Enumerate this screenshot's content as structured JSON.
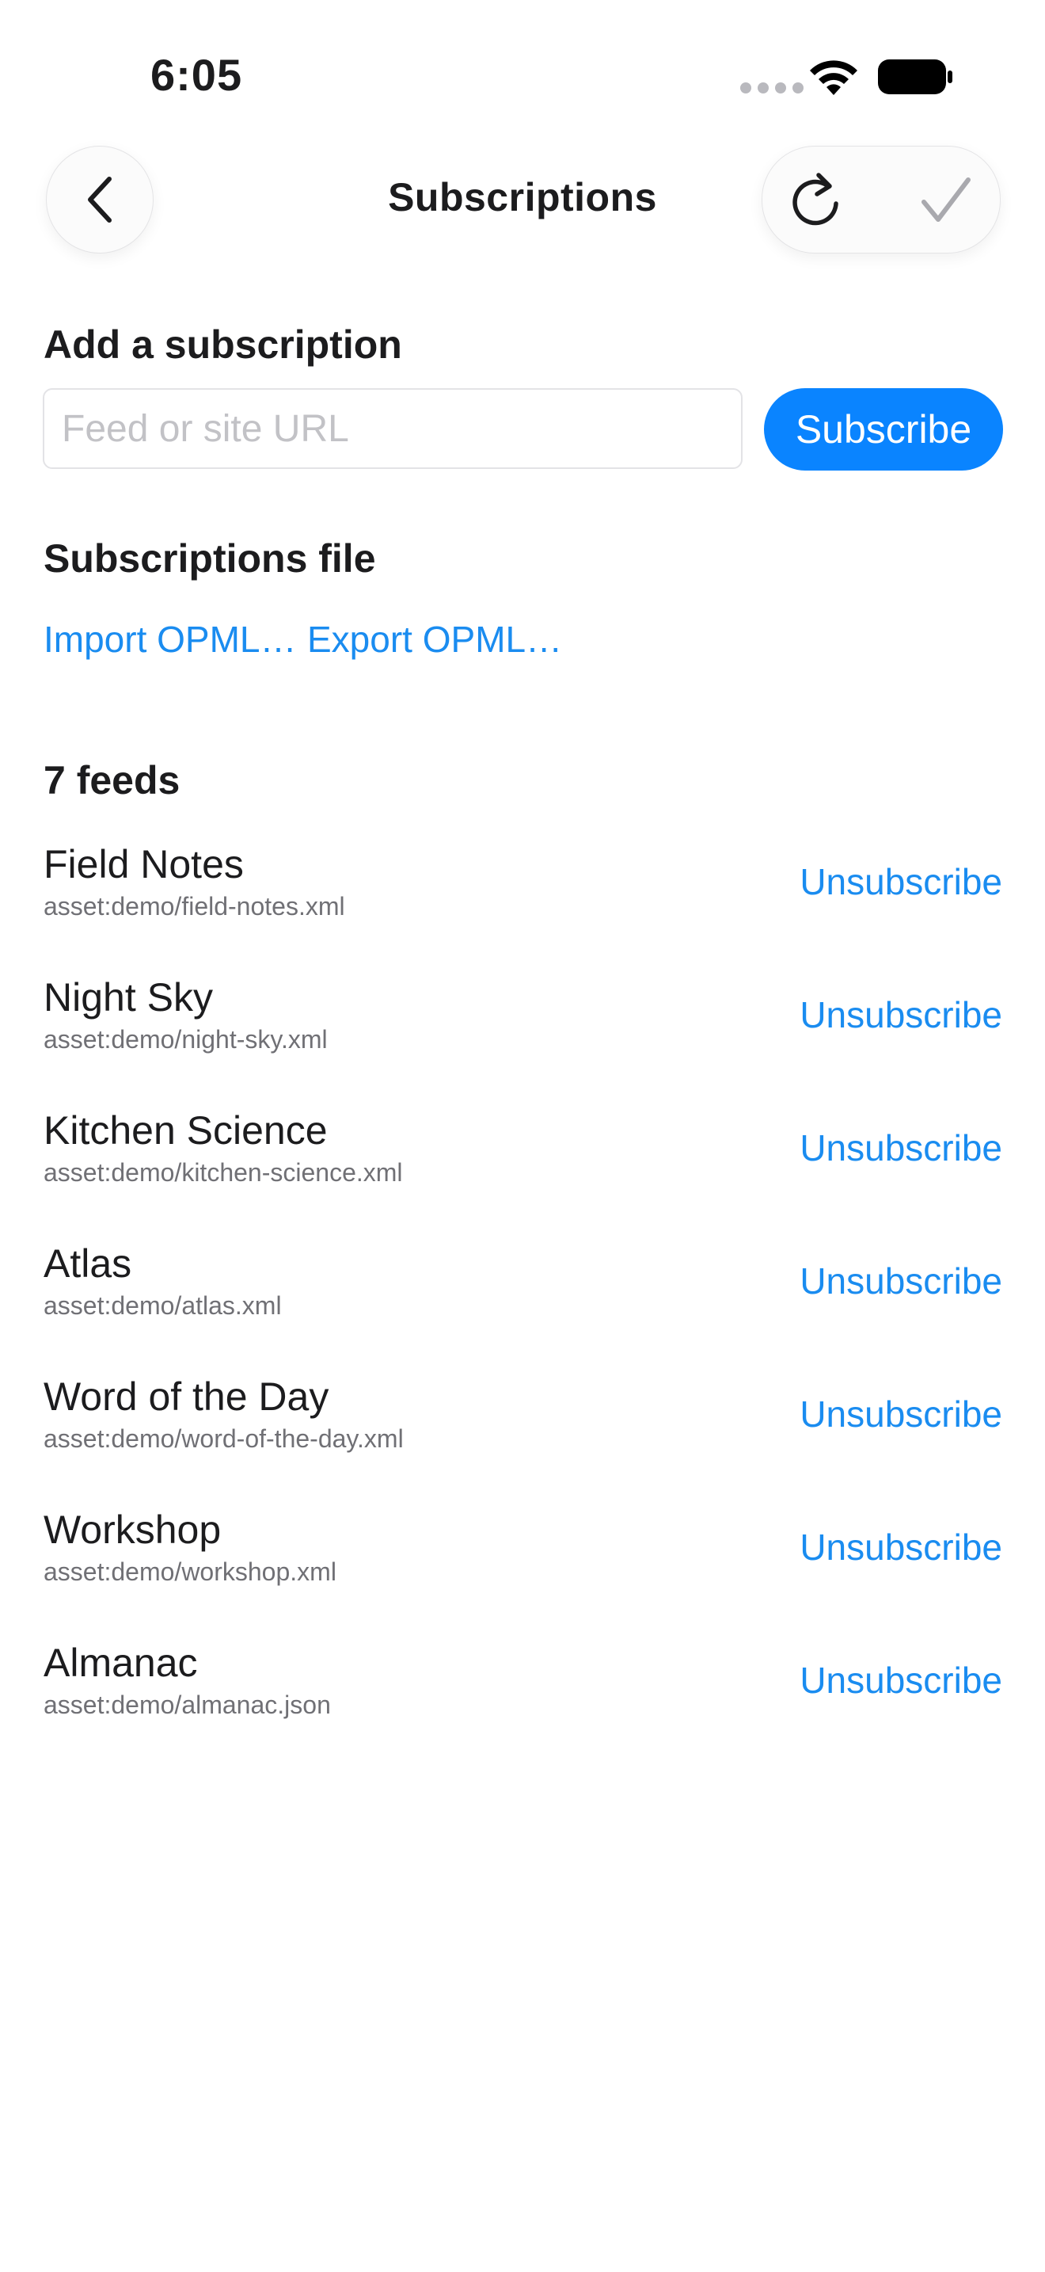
{
  "status_bar": {
    "time": "6:05"
  },
  "nav": {
    "title": "Subscriptions",
    "back_icon": "chevron-left-icon",
    "refresh_icon": "refresh-icon",
    "done_icon": "checkmark-icon"
  },
  "add_section": {
    "heading": "Add a subscription",
    "input_placeholder": "Feed or site URL",
    "input_value": "",
    "subscribe_label": "Subscribe"
  },
  "file_section": {
    "heading": "Subscriptions file",
    "import_label": "Import OPML…",
    "export_label": "Export OPML…"
  },
  "feeds": {
    "heading": "7 feeds",
    "unsubscribe_label": "Unsubscribe",
    "items": [
      {
        "title": "Field Notes",
        "url": "asset:demo/field-notes.xml"
      },
      {
        "title": "Night Sky",
        "url": "asset:demo/night-sky.xml"
      },
      {
        "title": "Kitchen Science",
        "url": "asset:demo/kitchen-science.xml"
      },
      {
        "title": "Atlas",
        "url": "asset:demo/atlas.xml"
      },
      {
        "title": "Word of the Day",
        "url": "asset:demo/word-of-the-day.xml"
      },
      {
        "title": "Workshop",
        "url": "asset:demo/workshop.xml"
      },
      {
        "title": "Almanac",
        "url": "asset:demo/almanac.json"
      }
    ]
  },
  "colors": {
    "accent": "#0a84ff",
    "link": "#1a8cf0",
    "text": "#1c1c1e",
    "secondary_text": "#707075"
  }
}
